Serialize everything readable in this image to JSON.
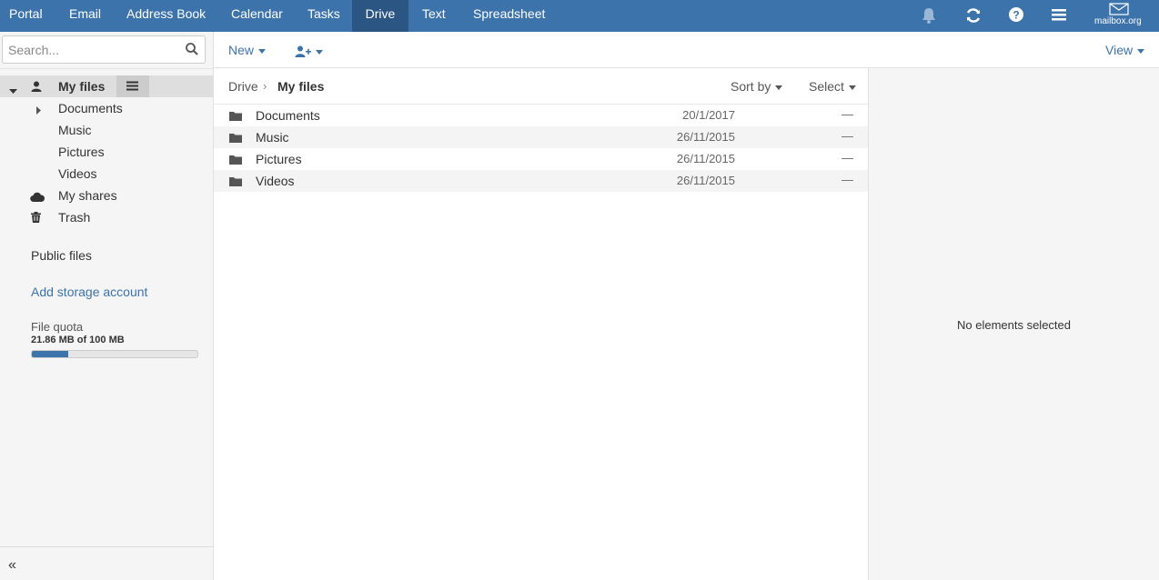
{
  "topnav": {
    "tabs": [
      {
        "label": "Portal"
      },
      {
        "label": "Email"
      },
      {
        "label": "Address Book"
      },
      {
        "label": "Calendar"
      },
      {
        "label": "Tasks"
      },
      {
        "label": "Drive",
        "active": true
      },
      {
        "label": "Text"
      },
      {
        "label": "Spreadsheet"
      }
    ],
    "icons": [
      "bell-icon",
      "refresh-icon",
      "help-icon",
      "menu-icon"
    ],
    "logo_text": "mailbox.org",
    "colors": {
      "bar": "#3c73aa",
      "active_tab": "#2b5683"
    }
  },
  "sidebar": {
    "search_placeholder": "Search...",
    "tree": {
      "root_label": "My files",
      "children": [
        "Documents",
        "Music",
        "Pictures",
        "Videos"
      ],
      "shares_label": "My shares",
      "trash_label": "Trash"
    },
    "public_files": "Public files",
    "add_storage": "Add storage account",
    "quota": {
      "title": "File quota",
      "value": "21.86 MB of 100 MB",
      "fraction": 0.2186
    },
    "collapse": "«"
  },
  "toolbar": {
    "new_label": "New",
    "share_icon": "add-user-icon",
    "view_label": "View"
  },
  "listing": {
    "breadcrumb": {
      "root": "Drive",
      "separator": "›",
      "current": "My files"
    },
    "sort_label": "Sort by",
    "select_label": "Select",
    "rows": [
      {
        "name": "Documents",
        "date": "20/1/2017",
        "size": "—"
      },
      {
        "name": "Music",
        "date": "26/11/2015",
        "size": "—"
      },
      {
        "name": "Pictures",
        "date": "26/11/2015",
        "size": "—"
      },
      {
        "name": "Videos",
        "date": "26/11/2015",
        "size": "—"
      }
    ]
  },
  "detail": {
    "empty_text": "No elements selected"
  }
}
